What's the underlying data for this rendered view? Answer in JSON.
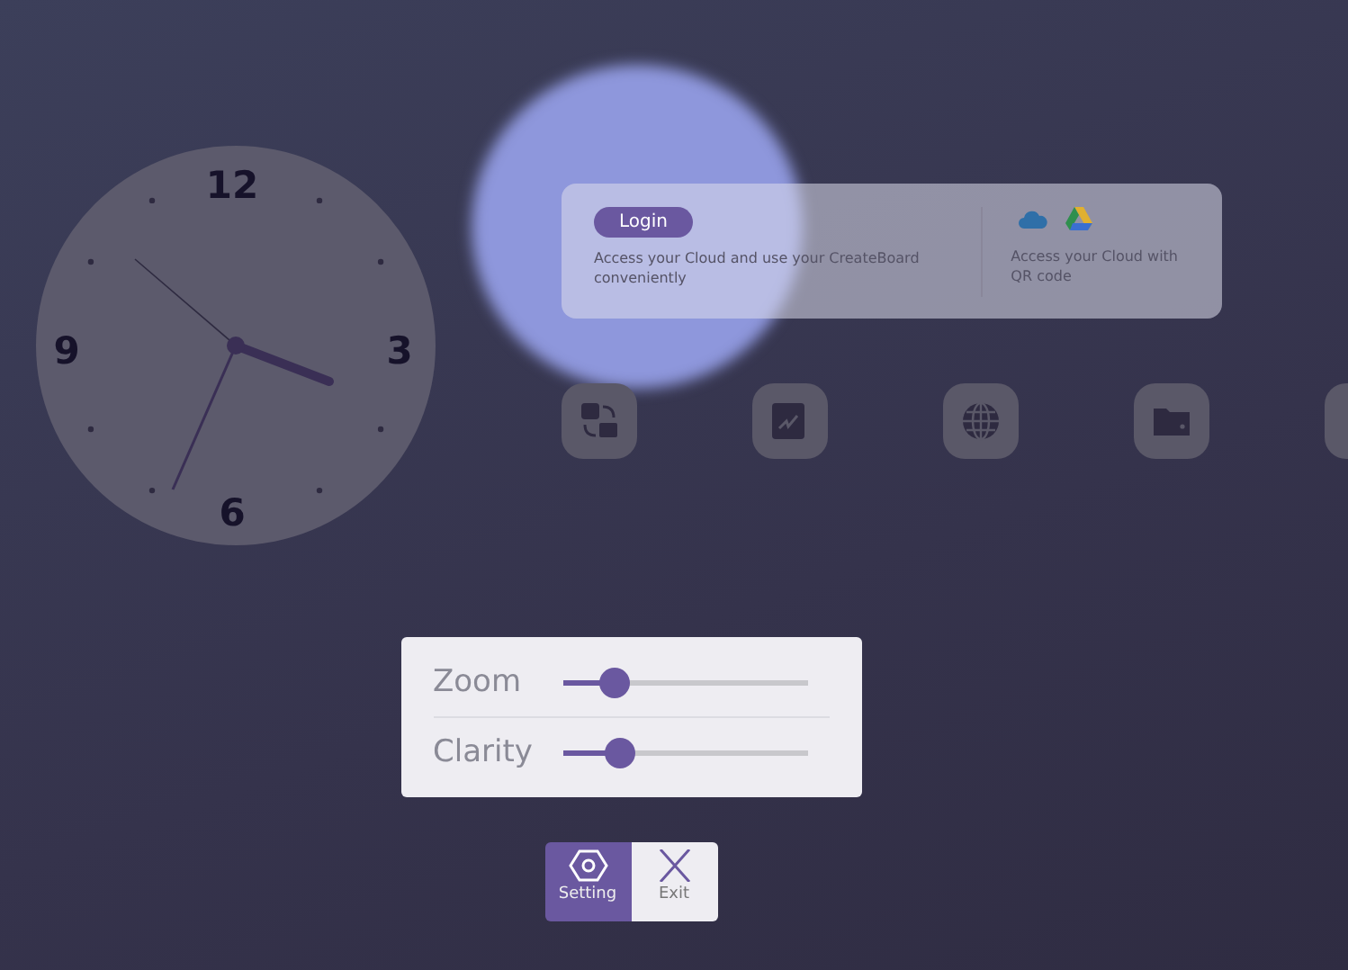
{
  "clock": {
    "numerals": [
      "12",
      "3",
      "6",
      "9"
    ]
  },
  "cloud_card": {
    "login_button": "Login",
    "description": "Access your Cloud and use your CreateBoard conveniently",
    "qr_text": "Access your Cloud with QR code"
  },
  "magnifier": {
    "sliders": [
      {
        "label": "Zoom",
        "level": 0.21
      },
      {
        "label": "Clarity",
        "level": 0.23
      }
    ]
  },
  "toolbar": [
    {
      "label": "Setting",
      "selected": true
    },
    {
      "label": "Exit",
      "selected": false
    }
  ]
}
